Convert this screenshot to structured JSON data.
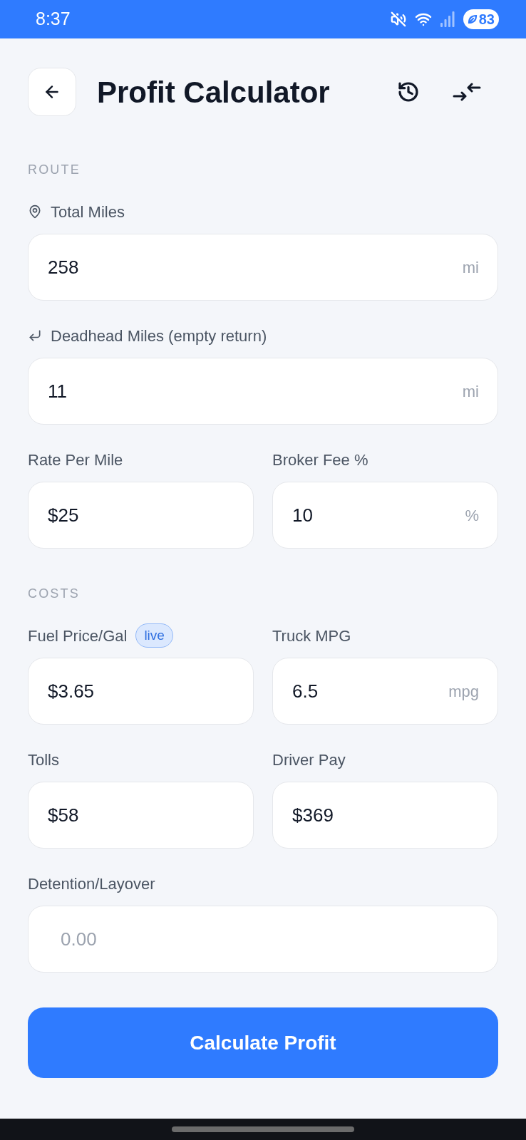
{
  "status_bar": {
    "time": "8:37",
    "battery": "83"
  },
  "header": {
    "title": "Profit Calculator"
  },
  "sections": [
    {
      "title": "ROUTE",
      "rows": [
        [
          {
            "label": "Total Miles",
            "value": "258",
            "unit": "mi"
          }
        ],
        [
          {
            "label": "Deadhead Miles (empty return)",
            "value": "11",
            "unit": "mi"
          }
        ],
        [
          {
            "label": "Rate Per Mile",
            "value": "$25"
          },
          {
            "label": "Broker Fee %",
            "value": "10",
            "unit": "%"
          }
        ]
      ]
    },
    {
      "title": "COSTS",
      "rows": [
        [
          {
            "label": "Fuel Price/Gal",
            "badge": "live",
            "value": "$3.65"
          },
          {
            "label": "Truck MPG",
            "value": "6.5",
            "unit": "mpg"
          }
        ],
        [
          {
            "label": "Tolls",
            "value": "$58"
          },
          {
            "label": "Driver Pay",
            "value": "$369"
          }
        ],
        [
          {
            "label": "Detention/Layover",
            "placeholder": "0.00"
          }
        ]
      ]
    }
  ],
  "submit_button": "Calculate Profit"
}
